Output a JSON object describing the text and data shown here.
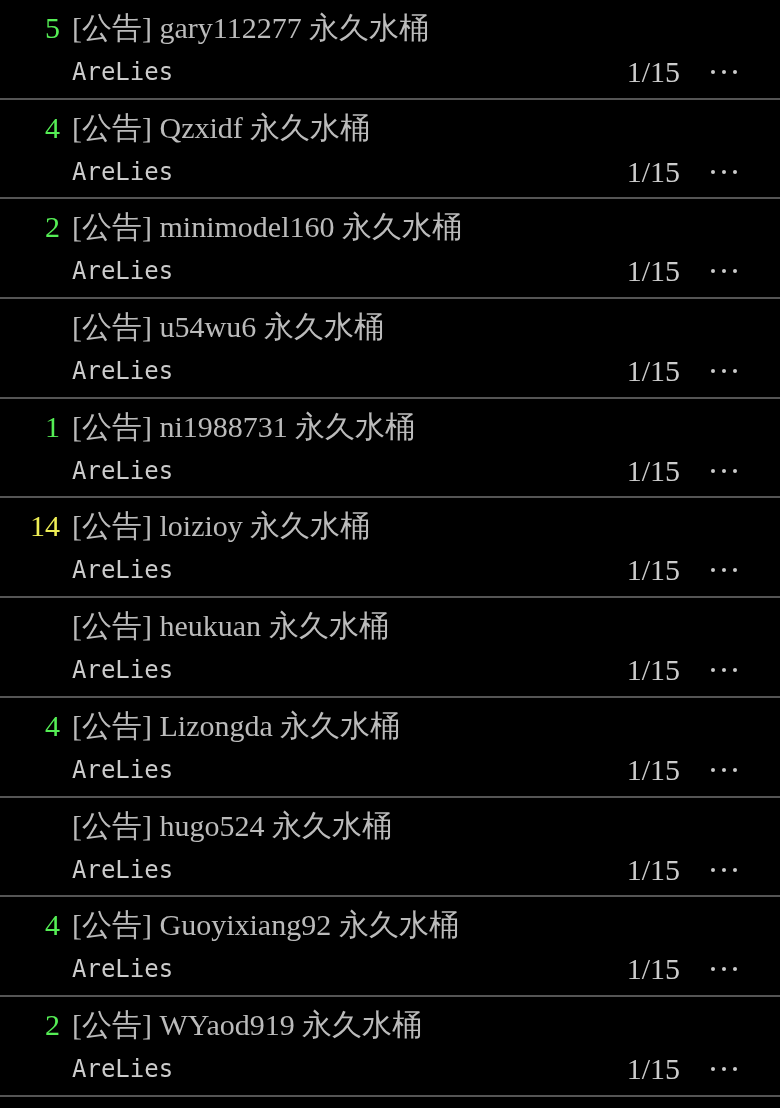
{
  "posts": [
    {
      "score": "5",
      "color": "#55ee55",
      "title": "[公告] gary112277 永久水桶",
      "author": "AreLies",
      "date": "1/15"
    },
    {
      "score": "4",
      "color": "#55ee55",
      "title": "[公告] Qzxidf 永久水桶",
      "author": "AreLies",
      "date": "1/15"
    },
    {
      "score": "2",
      "color": "#55ee55",
      "title": "[公告] minimodel160 永久水桶",
      "author": "AreLies",
      "date": "1/15"
    },
    {
      "title": "[公告] u54wu6 永久水桶",
      "author": "AreLies",
      "date": "1/15"
    },
    {
      "score": "1",
      "color": "#55ee55",
      "title": "[公告] ni1988731 永久水桶",
      "author": "AreLies",
      "date": "1/15"
    },
    {
      "score": "14",
      "color": "#eeee55",
      "title": "[公告] loizioy 永久水桶",
      "author": "AreLies",
      "date": "1/15"
    },
    {
      "title": "[公告] heukuan 永久水桶",
      "author": "AreLies",
      "date": "1/15"
    },
    {
      "score": "4",
      "color": "#55ee55",
      "title": "[公告] Lizongda 永久水桶",
      "author": "AreLies",
      "date": "1/15"
    },
    {
      "title": "[公告] hugo524 永久水桶",
      "author": "AreLies",
      "date": "1/15"
    },
    {
      "score": "4",
      "color": "#55ee55",
      "title": "[公告] Guoyixiang92 永久水桶",
      "author": "AreLies",
      "date": "1/15"
    },
    {
      "score": "2",
      "color": "#55ee55",
      "title": "[公告] WYaod919 永久水桶",
      "author": "AreLies",
      "date": "1/15"
    }
  ]
}
